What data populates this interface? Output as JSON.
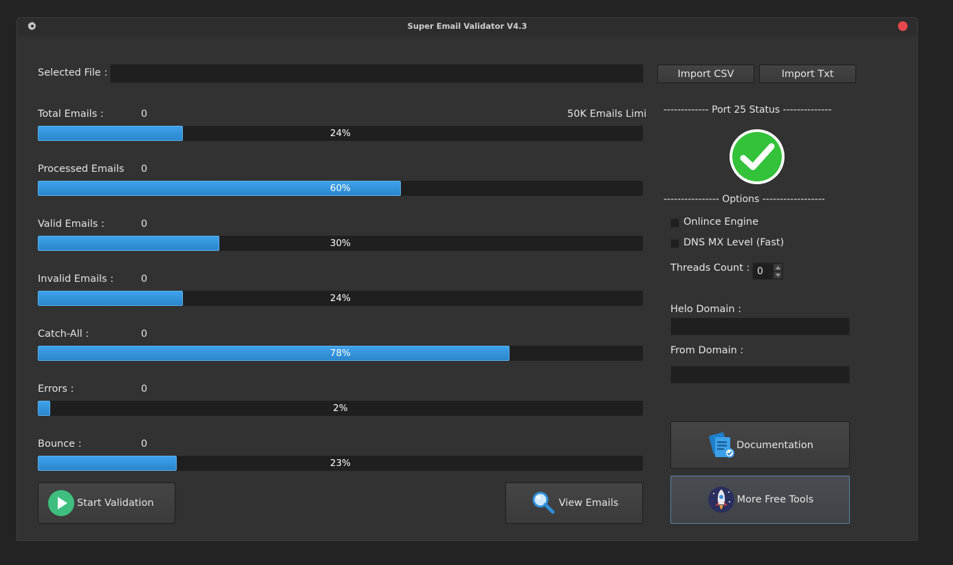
{
  "window": {
    "title": "Super Email Validator  V4.3"
  },
  "file": {
    "label": "Selected File :",
    "value": ""
  },
  "import": {
    "csv_label": "Import CSV",
    "txt_label": "Import Txt"
  },
  "limit_note": "50K Emails Limi",
  "stats": [
    {
      "label": "Total Emails :",
      "count": "0",
      "progress": 24,
      "progress_text": "24%"
    },
    {
      "label": "Processed Emails",
      "count": "0",
      "progress": 60,
      "progress_text": "60%"
    },
    {
      "label": "Valid Emails :",
      "count": "0",
      "progress": 30,
      "progress_text": "30%"
    },
    {
      "label": "Invalid Emails :",
      "count": "0",
      "progress": 24,
      "progress_text": "24%"
    },
    {
      "label": "Catch-All :",
      "count": "0",
      "progress": 78,
      "progress_text": "78%"
    },
    {
      "label": "Errors :",
      "count": "0",
      "progress": 2,
      "progress_text": "2%"
    },
    {
      "label": "Bounce :",
      "count": "0",
      "progress": 23,
      "progress_text": "23%"
    }
  ],
  "port25": {
    "heading": "-------------  Port 25 Status --------------",
    "status_icon": "green-check-icon",
    "status_color": "#33c23a"
  },
  "options": {
    "heading": "----------------  Options ------------------",
    "online_engine_label": "Onlince Engine",
    "online_engine_checked": false,
    "dns_mx_label": "DNS MX Level (Fast)",
    "dns_mx_checked": false,
    "threads_label": "Threads Count :",
    "threads_value": "0",
    "helo_label": "Helo Domain :",
    "helo_value": "",
    "from_label": "From Domain :",
    "from_value": ""
  },
  "actions": {
    "start_label": "Start Validation",
    "view_label": "View Emails",
    "docs_label": "Documentation",
    "tools_label": "More Free Tools"
  },
  "colors": {
    "progress_fill": "#3a9de5",
    "accent_border": "#5a87a8",
    "close_button": "#e5484d",
    "play_green": "#3fbf7f"
  }
}
